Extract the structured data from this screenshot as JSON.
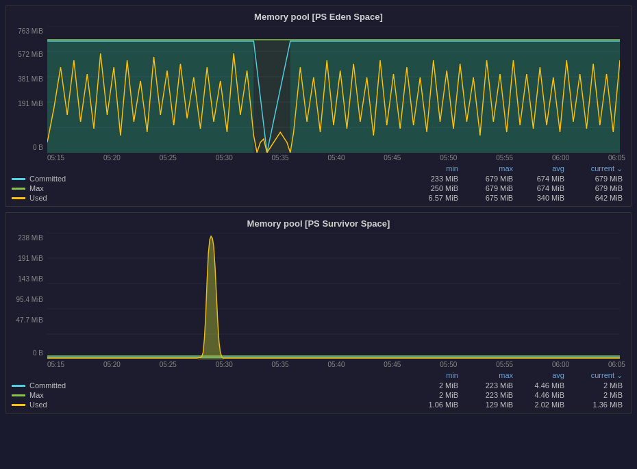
{
  "panel1": {
    "title": "Memory pool [PS Eden Space]",
    "yLabels": [
      "763 MiB",
      "572 MiB",
      "381 MiB",
      "191 MiB",
      "0 B"
    ],
    "xLabels": [
      "05:15",
      "05:20",
      "05:25",
      "05:30",
      "05:35",
      "05:40",
      "05:45",
      "05:50",
      "05:55",
      "06:00",
      "06:05"
    ],
    "legendHeader": {
      "min": "min",
      "max": "max",
      "avg": "avg",
      "current": "current ⌄"
    },
    "rows": [
      {
        "label": "Committed",
        "color": "#4dd0e1",
        "min": "233 MiB",
        "max": "679 MiB",
        "avg": "674 MiB",
        "current": "679 MiB"
      },
      {
        "label": "Max",
        "color": "#8bc34a",
        "min": "250 MiB",
        "max": "679 MiB",
        "avg": "674 MiB",
        "current": "679 MiB"
      },
      {
        "label": "Used",
        "color": "#ffc107",
        "min": "6.57 MiB",
        "max": "675 MiB",
        "avg": "340 MiB",
        "current": "642 MiB"
      }
    ]
  },
  "panel2": {
    "title": "Memory pool [PS Survivor Space]",
    "yLabels": [
      "238 MiB",
      "191 MiB",
      "143 MiB",
      "95.4 MiB",
      "47.7 MiB",
      "0 B"
    ],
    "xLabels": [
      "05:15",
      "05:20",
      "05:25",
      "05:30",
      "05:35",
      "05:40",
      "05:45",
      "05:50",
      "05:55",
      "06:00",
      "06:05"
    ],
    "legendHeader": {
      "min": "min",
      "max": "max",
      "avg": "avg",
      "current": "current ⌄"
    },
    "rows": [
      {
        "label": "Committed",
        "color": "#4dd0e1",
        "min": "2 MiB",
        "max": "223 MiB",
        "avg": "4.46 MiB",
        "current": "2 MiB"
      },
      {
        "label": "Max",
        "color": "#8bc34a",
        "min": "2 MiB",
        "max": "223 MiB",
        "avg": "4.46 MiB",
        "current": "2 MiB"
      },
      {
        "label": "Used",
        "color": "#ffc107",
        "min": "1.06 MiB",
        "max": "129 MiB",
        "avg": "2.02 MiB",
        "current": "1.36 MiB"
      }
    ]
  }
}
